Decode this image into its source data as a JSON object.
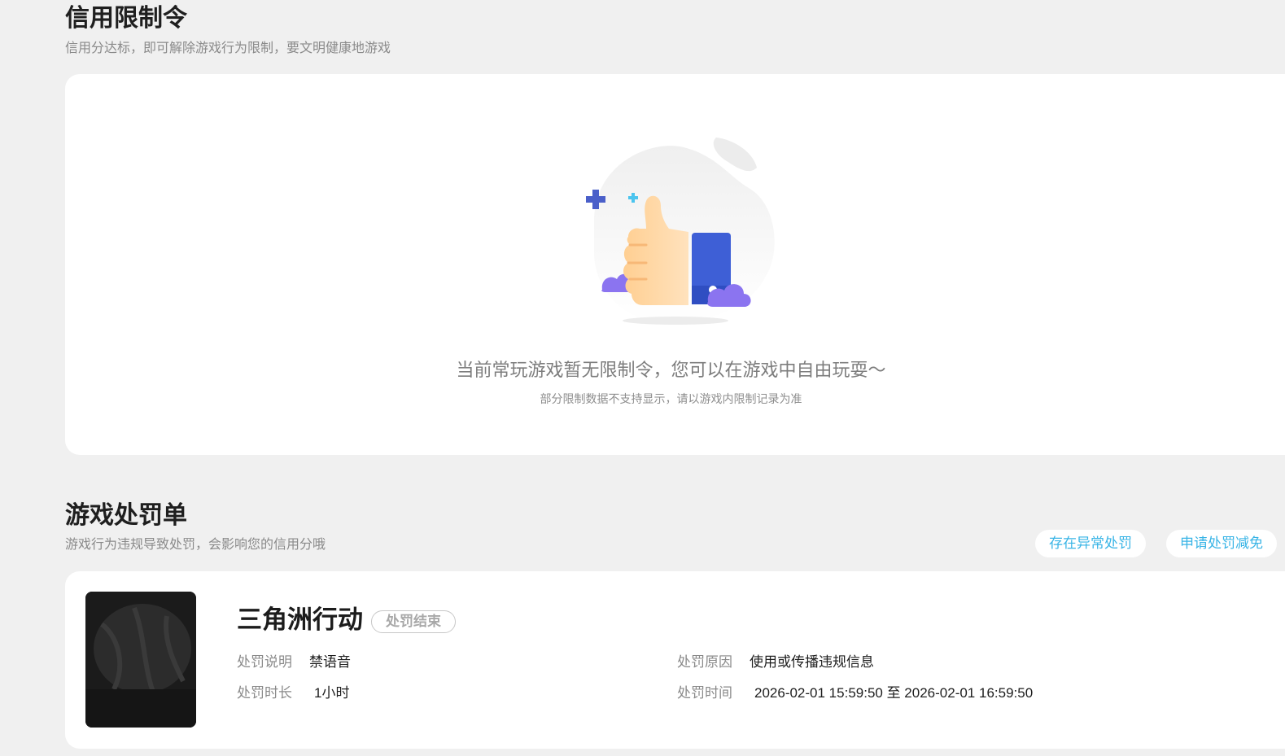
{
  "restriction": {
    "title": "信用限制令",
    "subtitle": "信用分达标，即可解除游戏行为限制，要文明健康地游戏",
    "empty_message": "当前常玩游戏暂无限制令，您可以在游戏中自由玩耍～",
    "empty_note": "部分限制数据不支持显示，请以游戏内限制记录为准"
  },
  "penalty": {
    "title": "游戏处罚单",
    "subtitle": "游戏行为违规导致处罚，会影响您的信用分哦",
    "buttons": {
      "abnormal": "存在异常处罚",
      "reduce": "申请处罚减免"
    },
    "record": {
      "game_name": "三角洲行动",
      "status": "处罚结束",
      "description_label": "处罚说明",
      "description_value": "禁语音",
      "duration_label": "处罚时长",
      "duration_value": "1小时",
      "reason_label": "处罚原因",
      "reason_value": "使用或传播违规信息",
      "time_label": "处罚时间",
      "time_value": "2026-02-01 15:59:50 至 2026-02-01 16:59:50"
    }
  },
  "colors": {
    "accent": "#38b4e6",
    "thumb_cuff": "#3e5fd6",
    "cloud": "#8b74f0",
    "sparkle": "#4a5fc9"
  },
  "icons": {
    "illustration": "thumbs-up-icon"
  }
}
